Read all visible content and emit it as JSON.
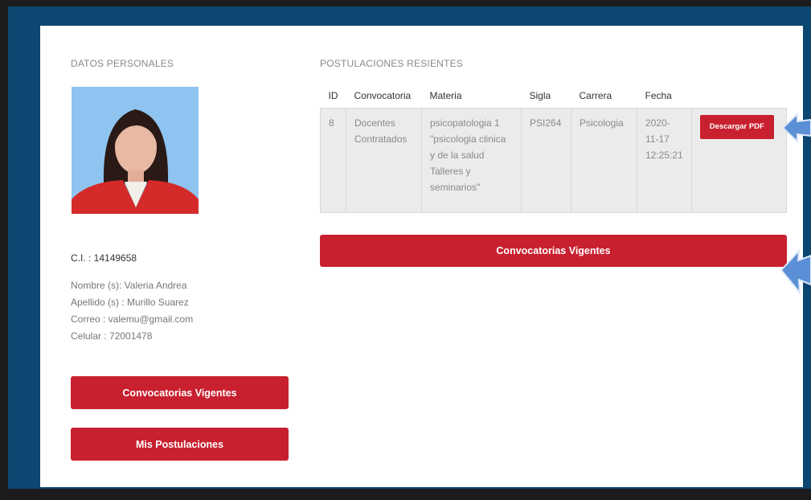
{
  "personal": {
    "section_title": "DATOS PERSONALES",
    "ci": "C.I. : 14149658",
    "nombre": "Nombre (s): Valeria Andrea",
    "apellido": "Apellido (s) : Murillo Suarez",
    "correo": "Correo : valemu@gmail.com",
    "celular": "Celular : 72001478",
    "btn_convocatorias": "Convocatorias Vigentes",
    "btn_postulaciones": "Mis Postulaciones"
  },
  "postulaciones": {
    "section_title": "POSTULACIONES RESIENTES",
    "headers": [
      "ID",
      "Convocatoria",
      "Materia",
      "Sigla",
      "Carrera",
      "Fecha"
    ],
    "rows": [
      {
        "id": "8",
        "convocatoria": "Docentes Contratados",
        "materia": "psicopatologia 1 \"psicologia clinica y de la salud Talleres y seminarios\"",
        "sigla": "PSI264",
        "carrera": "Psicologia",
        "fecha": "2020-11-17 12:25:21",
        "action": "Descargar PDF"
      }
    ],
    "btn_convocatorias": "Convocatorias Vigentes"
  },
  "colors": {
    "accent": "#c8202f",
    "frame": "#0d4670",
    "arrow": "#5b8fd6"
  },
  "icons": {
    "pointer_arrow": "left-pointing-arrow"
  }
}
